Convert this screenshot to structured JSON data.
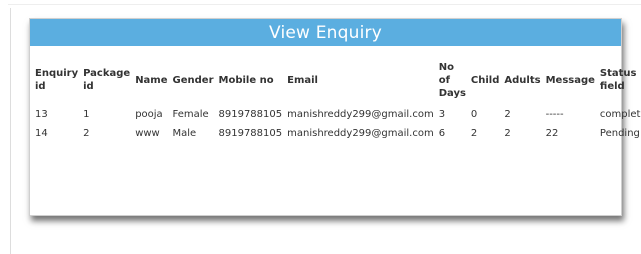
{
  "panel": {
    "title": "View Enquiry"
  },
  "table": {
    "headers": [
      "Enquiry id",
      "Package id",
      "Name",
      "Gender",
      "Mobile no",
      "Email",
      "No of Days",
      "Child",
      "Adults",
      "Message",
      "Status field"
    ],
    "rows": [
      [
        "13",
        "1",
        "pooja",
        "Female",
        "8919788105",
        "manishreddy299@gmail.com",
        "3",
        "0",
        "2",
        "-----",
        "completed"
      ],
      [
        "14",
        "2",
        "www",
        "Male",
        "8919788105",
        "manishreddy299@gmail.com",
        "6",
        "2",
        "2",
        "22",
        "Pending"
      ]
    ]
  }
}
